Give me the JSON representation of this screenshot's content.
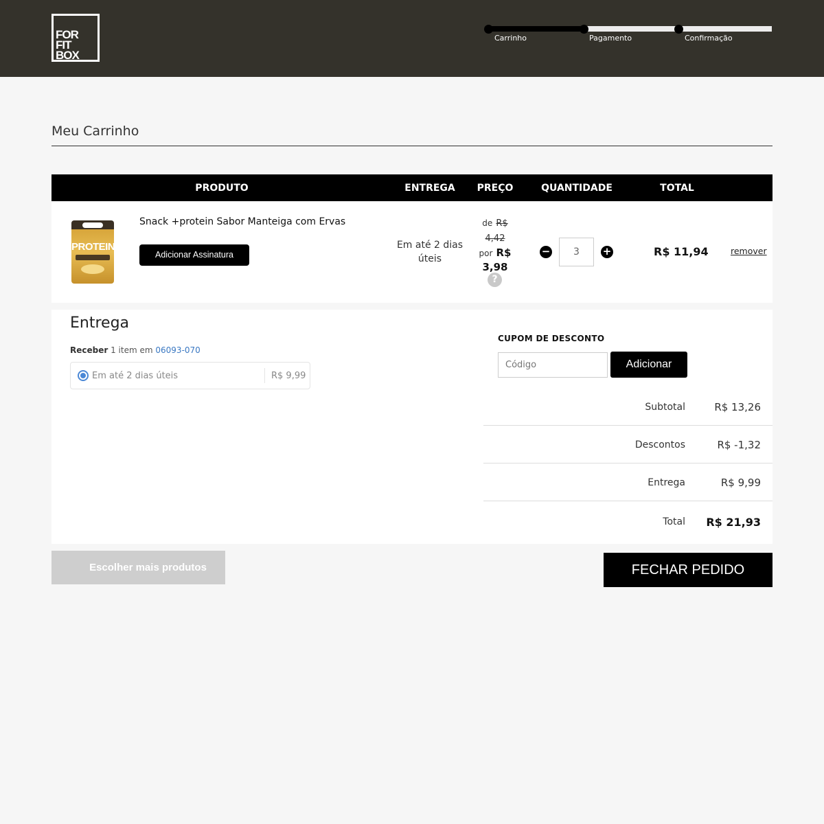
{
  "header": {
    "logo": [
      "FOR",
      "FIT",
      "BOX"
    ],
    "steps": [
      {
        "label": "Carrinho"
      },
      {
        "label": "Pagamento"
      },
      {
        "label": "Confirmação"
      }
    ],
    "progress_completed_steps": 2
  },
  "page": {
    "title": "Meu Carrinho"
  },
  "table": {
    "headers": {
      "product": "PRODUTO",
      "delivery": "ENTREGA",
      "price": "PREÇO",
      "quantity": "QUANTIDADE",
      "total": "TOTAL"
    },
    "item": {
      "name": "Snack +protein Sabor Manteiga com Ervas",
      "image_text": "PROTEIN",
      "subscription_button": "Adicionar Assinatura",
      "delivery": "Em até 2 dias úteis",
      "price_from_prefix": "de",
      "price_old": "R$ 4,42",
      "price_to_prefix": "por",
      "price_new": "R$ 3,98",
      "help_icon": "?",
      "quantity": "3",
      "minus_icon": "−",
      "plus_icon": "+",
      "total": "R$ 11,94",
      "remove": "remover"
    }
  },
  "delivery": {
    "title": "Entrega",
    "receive_prefix": "Receber",
    "receive_middle": "1 item em",
    "zip": "06093-070",
    "option_label": "Em até 2 dias úteis",
    "option_price": "R$ 9,99",
    "option_selected": true
  },
  "coupon": {
    "title": "CUPOM DE DESCONTO",
    "placeholder": "Código",
    "button": "Adicionar"
  },
  "summary": {
    "subtotal_label": "Subtotal",
    "subtotal_value": "R$ 13,26",
    "discount_label": "Descontos",
    "discount_value": "R$ -1,32",
    "shipping_label": "Entrega",
    "shipping_value": "R$ 9,99",
    "total_label": "Total",
    "total_value": "R$ 21,93"
  },
  "actions": {
    "more_products": "Escolher mais produtos",
    "checkout": "FECHAR PEDIDO"
  },
  "colors": {
    "header_bg": "#34322b",
    "accent": "#000000",
    "link_blue": "#3a78c2",
    "disabled_button": "#cecece"
  }
}
